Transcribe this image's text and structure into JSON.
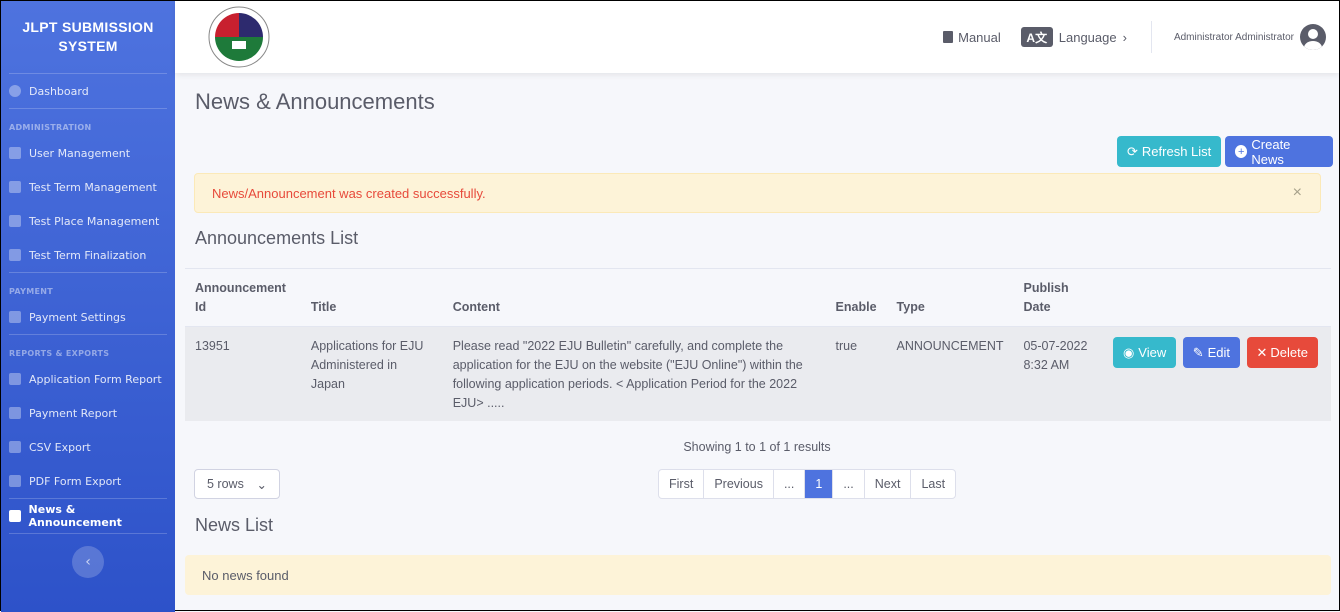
{
  "sidebar": {
    "brand": "JLPT SUBMISSION SYSTEM",
    "dashboard": "Dashboard",
    "sections": [
      {
        "heading": "ADMINISTRATION",
        "items": [
          "User Management",
          "Test Term Management",
          "Test Place Management",
          "Test Term Finalization"
        ]
      },
      {
        "heading": "PAYMENT",
        "items": [
          "Payment Settings"
        ]
      },
      {
        "heading": "REPORTS & EXPORTS",
        "items": [
          "Application Form Report",
          "Payment Report",
          "CSV Export",
          "PDF Form Export"
        ]
      }
    ],
    "active": "News & Announcement",
    "toggle": "‹"
  },
  "topbar": {
    "manual": "Manual",
    "language": "Language",
    "user": "Administrator Administrator"
  },
  "page": {
    "title": "News & Announcements",
    "refresh": "Refresh List",
    "create": "Create News",
    "alert": "News/Announcement was created successfully.",
    "alert_close": "×",
    "announcements_title": "Announcements List",
    "columns": [
      "Announcement Id",
      "Title",
      "Content",
      "Enable",
      "Type",
      "Publish Date"
    ],
    "rows": [
      {
        "id": "13951",
        "title": "Applications for EJU Administered in Japan",
        "content": "Please read \"2022 EJU Bulletin\" carefully, and complete the application for the EJU on the website (\"EJU Online\") within the following application periods. < Application Period for the 2022 EJU> .....",
        "enable": "true",
        "type": "ANNOUNCEMENT",
        "date": "05-07-2022 8:32 AM"
      }
    ],
    "actions": {
      "view": "View",
      "edit": "Edit",
      "delete": "Delete"
    },
    "showing": "Showing 1 to 1 of 1 results",
    "rows_select": "5 rows",
    "pager": [
      "First",
      "Previous",
      "...",
      "1",
      "...",
      "Next",
      "Last"
    ],
    "current_page": "1",
    "news_title": "News List",
    "no_news": "No news found"
  },
  "colors": {
    "primary": "#4e73df",
    "info": "#36b9cc",
    "danger": "#e74a3b",
    "warning_bg": "#fdf3d8",
    "alert_text": "#e74a3b"
  }
}
